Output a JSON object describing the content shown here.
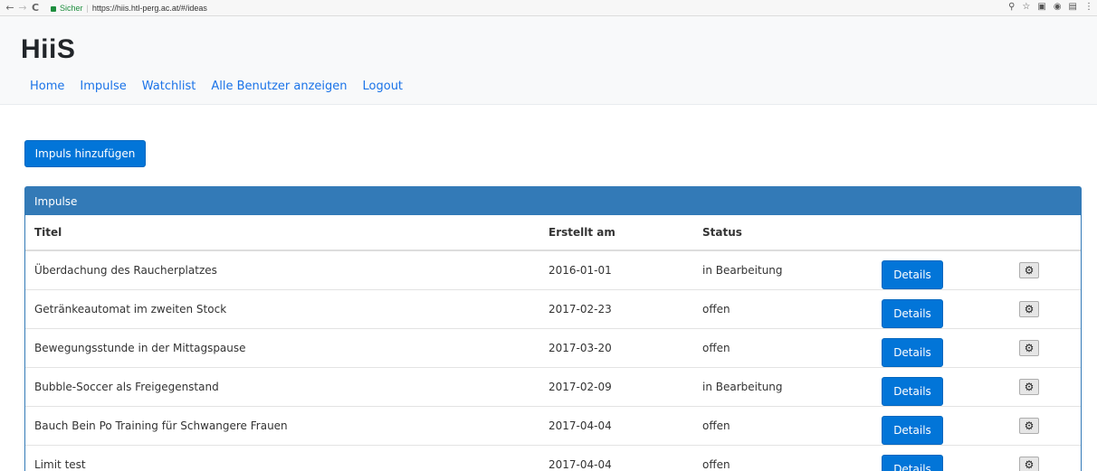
{
  "browser": {
    "back": "←",
    "forward": "→",
    "reload": "C",
    "secure_label": "Sicher",
    "url": "https://hiis.htl-perg.ac.at/#/ideas"
  },
  "header": {
    "brand": "HiiS",
    "nav": [
      "Home",
      "Impulse",
      "Watchlist",
      "Alle Benutzer anzeigen",
      "Logout"
    ]
  },
  "add_button": "Impuls hinzufügen",
  "panel": {
    "title": "Impulse",
    "columns": {
      "title": "Titel",
      "created": "Erstellt am",
      "status": "Status"
    },
    "details_label": "Details",
    "rows": [
      {
        "title": "Überdachung des Raucherplatzes",
        "created": "2016-01-01",
        "status": "in Bearbeitung"
      },
      {
        "title": "Getränkeautomat im zweiten Stock",
        "created": "2017-02-23",
        "status": "offen"
      },
      {
        "title": "Bewegungsstunde in der Mittagspause",
        "created": "2017-03-20",
        "status": "offen"
      },
      {
        "title": "Bubble-Soccer als Freigegenstand",
        "created": "2017-02-09",
        "status": "in Bearbeitung"
      },
      {
        "title": "Bauch Bein Po Training für Schwangere Frauen",
        "created": "2017-04-04",
        "status": "offen"
      },
      {
        "title": "Limit test",
        "created": "2017-04-04",
        "status": "offen"
      }
    ]
  },
  "colors": {
    "primary": "#0275d8",
    "panel_heading": "#337ab7",
    "link": "#1a73e8"
  }
}
